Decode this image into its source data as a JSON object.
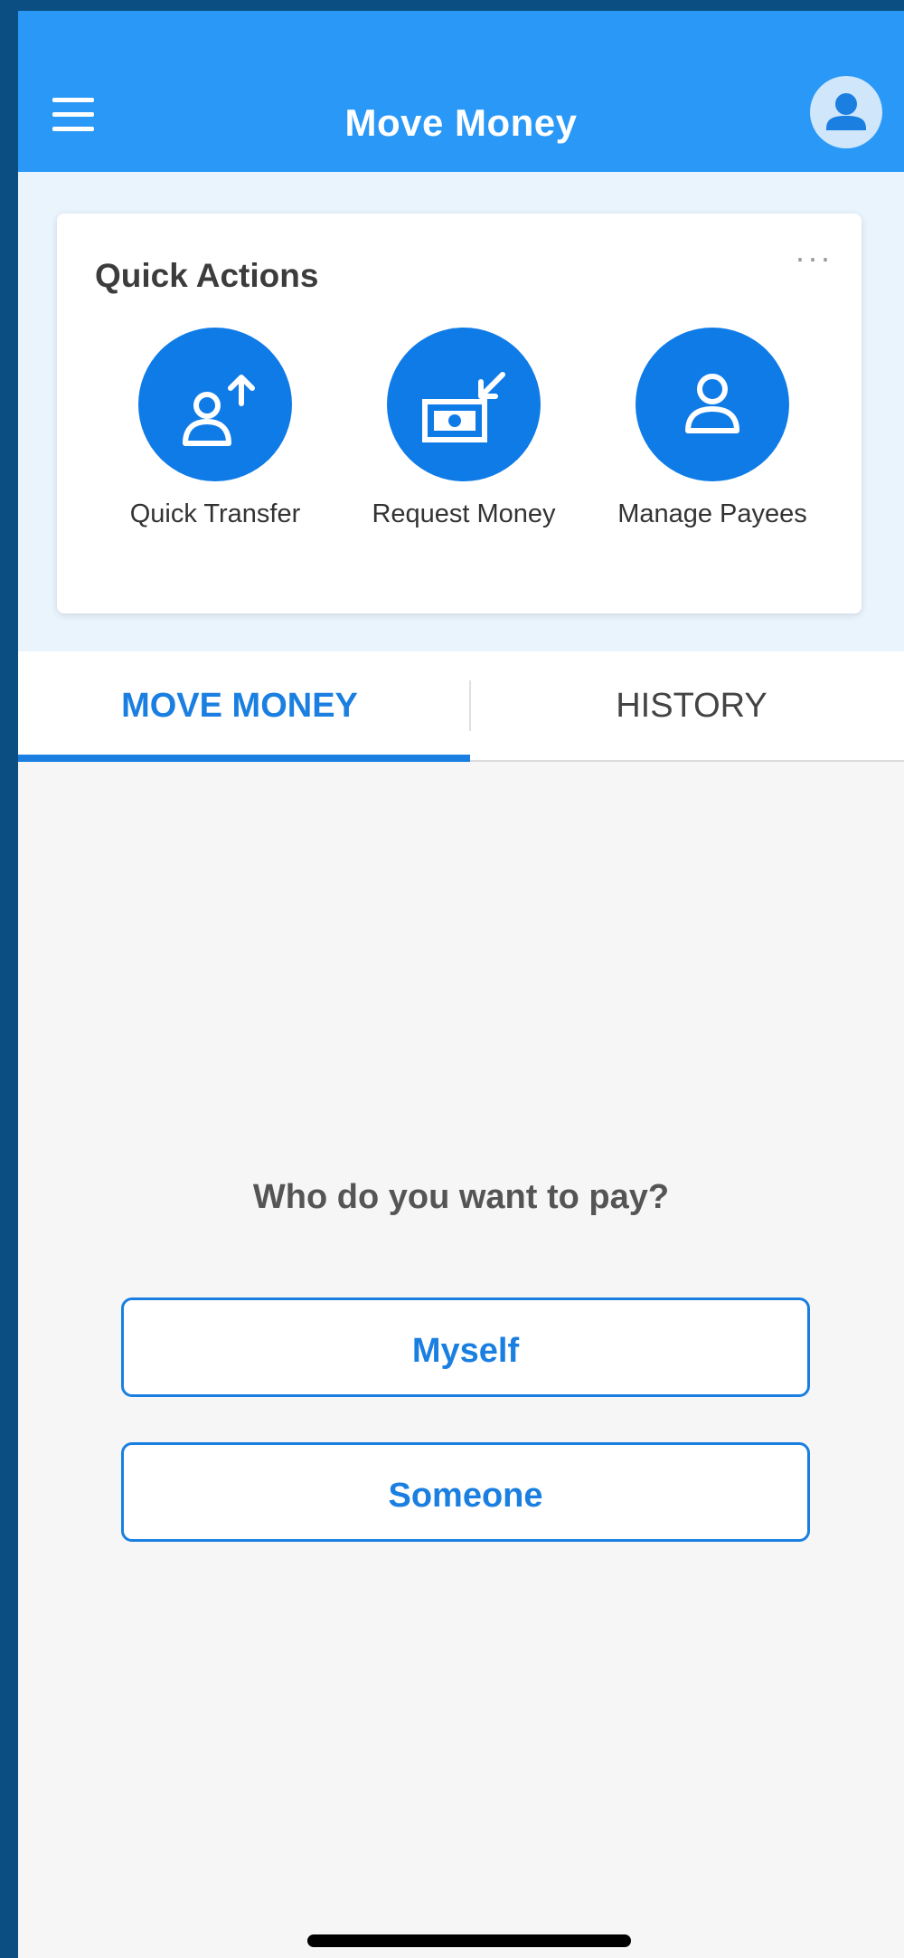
{
  "header": {
    "title": "Move Money"
  },
  "quick_actions": {
    "title": "Quick Actions",
    "more": "···",
    "items": [
      {
        "label": "Quick Transfer",
        "icon": "user-arrow-up-icon"
      },
      {
        "label": "Request Money",
        "icon": "money-arrow-in-icon"
      },
      {
        "label": "Manage Payees",
        "icon": "user-icon"
      }
    ]
  },
  "tabs": [
    {
      "label": "MOVE MONEY",
      "active": true
    },
    {
      "label": "HISTORY",
      "active": false
    }
  ],
  "main": {
    "prompt": "Who do you want to pay?",
    "options": [
      {
        "label": "Myself"
      },
      {
        "label": "Someone"
      }
    ]
  },
  "colors": {
    "header": "#2a98f7",
    "accent": "#1a7fe0",
    "action_circle": "#0f7be7",
    "outer_frame": "#0a4e82"
  }
}
